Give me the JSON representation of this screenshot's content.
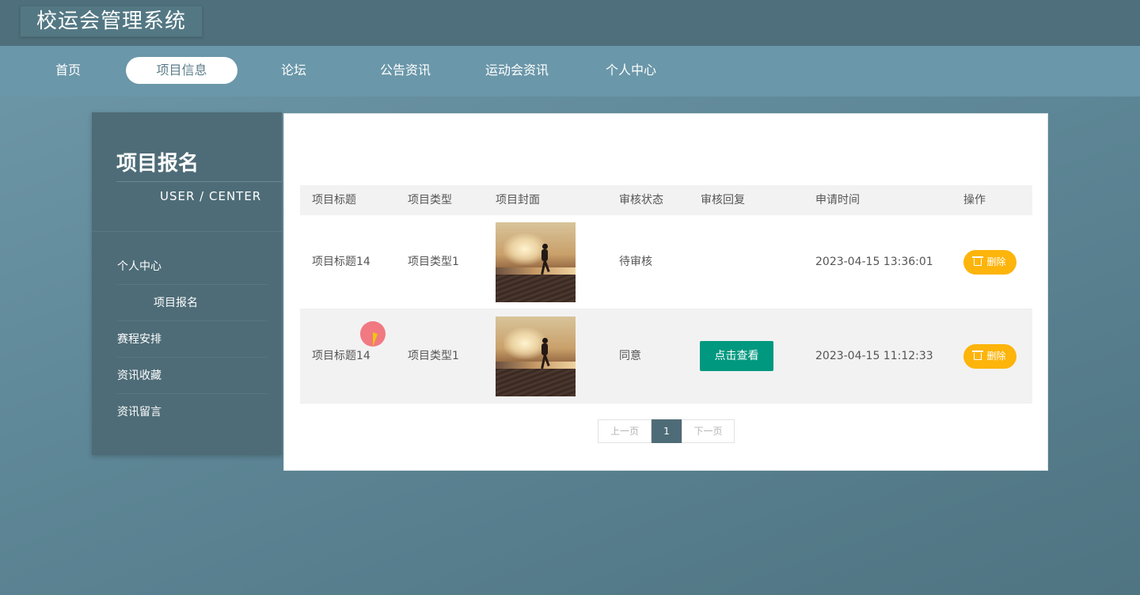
{
  "app": {
    "title": "校运会管理系统"
  },
  "nav": {
    "items": [
      {
        "label": "首页"
      },
      {
        "label": "项目信息",
        "active": true
      },
      {
        "label": "论坛"
      },
      {
        "label": "公告资讯"
      },
      {
        "label": "运动会资讯"
      },
      {
        "label": "个人中心"
      }
    ]
  },
  "sidebar": {
    "title": "项目报名",
    "subtitle": "USER / CENTER",
    "items": [
      {
        "label": "个人中心"
      },
      {
        "label": "项目报名",
        "sub": true
      },
      {
        "label": "赛程安排"
      },
      {
        "label": "资讯收藏"
      },
      {
        "label": "资讯留言"
      }
    ]
  },
  "table": {
    "headers": [
      "项目标题",
      "项目类型",
      "项目封面",
      "审核状态",
      "审核回复",
      "申请时间",
      "操作"
    ],
    "rows": [
      {
        "title": "项目标题14",
        "type": "项目类型1",
        "status": "待审核",
        "reply": "",
        "time": "2023-04-15 13:36:01",
        "delete_label": "删除"
      },
      {
        "title": "项目标题14",
        "type": "项目类型1",
        "status": "同意",
        "reply": "点击查看",
        "time": "2023-04-15 11:12:33",
        "delete_label": "删除"
      }
    ]
  },
  "pagination": {
    "prev": "上一页",
    "current": "1",
    "next": "下一页"
  },
  "colors": {
    "accent": "#4e6c77",
    "view_button": "#00987f",
    "delete_button": "#fdb40b"
  },
  "icons": {
    "delete": "trash-icon",
    "cover": "runner-photo"
  }
}
